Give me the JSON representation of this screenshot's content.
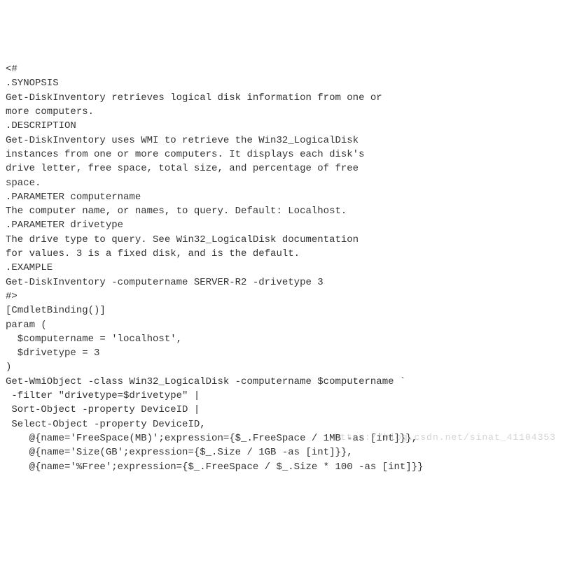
{
  "code": {
    "lines": [
      "<#",
      ".SYNOPSIS",
      "Get-DiskInventory retrieves logical disk information from one or",
      "more computers.",
      ".DESCRIPTION",
      "Get-DiskInventory uses WMI to retrieve the Win32_LogicalDisk",
      "instances from one or more computers. It displays each disk's",
      "drive letter, free space, total size, and percentage of free",
      "space.",
      ".PARAMETER computername",
      "",
      "The computer name, or names, to query. Default: Localhost.",
      ".PARAMETER drivetype",
      "The drive type to query. See Win32_LogicalDisk documentation",
      "for values. 3 is a fixed disk, and is the default.",
      ".EXAMPLE",
      "Get-DiskInventory -computername SERVER-R2 -drivetype 3",
      "#>",
      "[CmdletBinding()]",
      "param (",
      "  $computername = 'localhost',",
      "  $drivetype = 3",
      ")",
      "Get-WmiObject -class Win32_LogicalDisk -computername $computername `",
      " -filter \"drivetype=$drivetype\" |",
      " Sort-Object -property DeviceID |",
      " Select-Object -property DeviceID,",
      "    @{name='FreeSpace(MB)';expression={$_.FreeSpace / 1MB -as [int]}},",
      "    @{name='Size(GB';expression={$_.Size / 1GB -as [int]}},",
      "    @{name='%Free';expression={$_.FreeSpace / $_.Size * 100 -as [int]}}"
    ]
  },
  "watermark": "https://blog.csdn.net/sinat_41104353"
}
